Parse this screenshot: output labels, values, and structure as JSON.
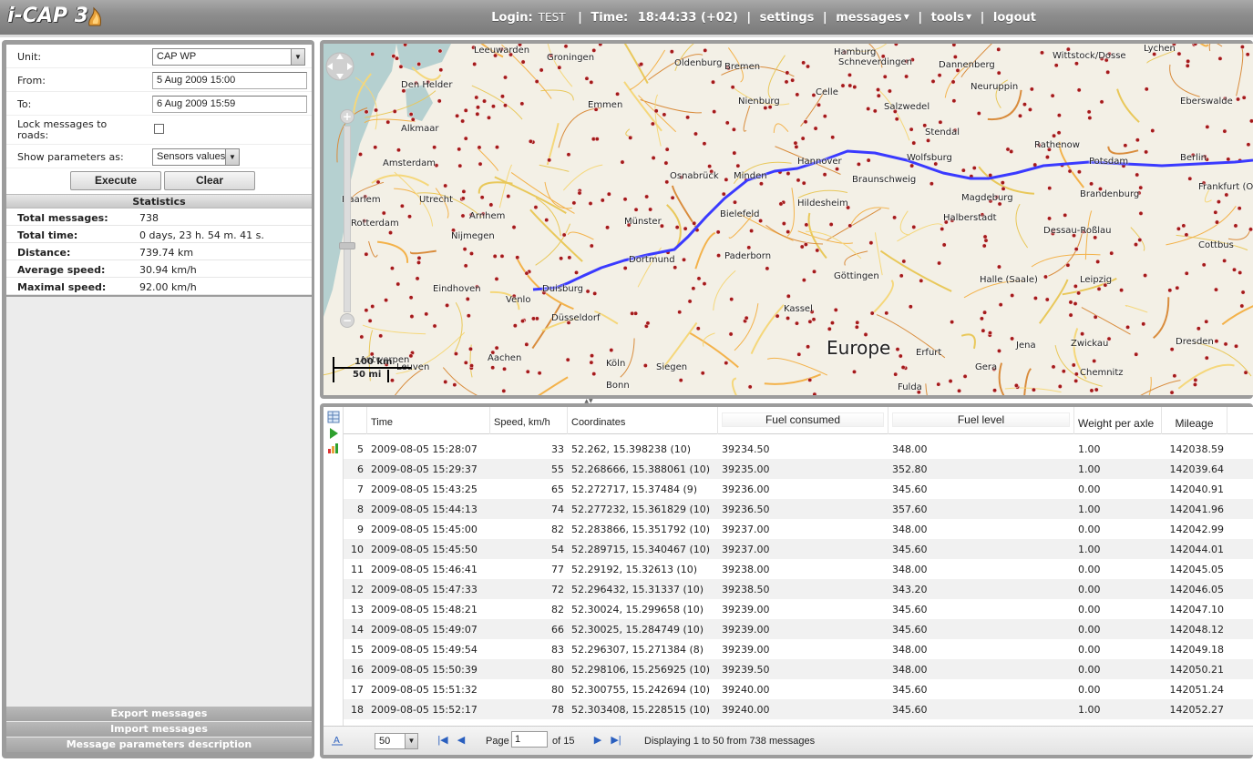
{
  "app": {
    "logo": "i-CAP 3"
  },
  "topnav": {
    "login_label": "Login:",
    "login_value": "TEST",
    "time_label": "Time:",
    "time_value": "18:44:33 (+02)",
    "settings": "settings",
    "messages": "messages",
    "tools": "tools",
    "logout": "logout"
  },
  "form": {
    "unit_label": "Unit:",
    "unit_value": "CAP WP",
    "from_label": "From:",
    "from_value": "5 Aug 2009 15:00",
    "to_label": "To:",
    "to_value": "6 Aug 2009 15:59",
    "lock_label_1": "Lock messages to",
    "lock_label_2": "roads:",
    "lock_checked": false,
    "show_label": "Show parameters as:",
    "show_value": "Sensors values",
    "execute": "Execute",
    "clear": "Clear"
  },
  "stats": {
    "title": "Statistics",
    "rows": [
      {
        "key": "Total messages:",
        "value": "738"
      },
      {
        "key": "Total time:",
        "value": "0 days, 23 h. 54 m. 41 s."
      },
      {
        "key": "Distance:",
        "value": "739.74 km"
      },
      {
        "key": "Average speed:",
        "value": "30.94 km/h"
      },
      {
        "key": "Maximal speed:",
        "value": "92.00 km/h"
      }
    ]
  },
  "bottom_links": {
    "export": "Export messages",
    "import": "Import messages",
    "description": "Message parameters description"
  },
  "map": {
    "region_label": "Europe",
    "scale_km": "100 km",
    "scale_mi": "50 mi",
    "cities": [
      {
        "name": "Leeuwarden"
      },
      {
        "name": "Groningen"
      },
      {
        "name": "Oldenburg"
      },
      {
        "name": "Bremen"
      },
      {
        "name": "Hamburg"
      },
      {
        "name": "Schneverdingen"
      },
      {
        "name": "Dannenberg"
      },
      {
        "name": "Wittstock/Dosse"
      },
      {
        "name": "Lychen"
      },
      {
        "name": "Den Helder"
      },
      {
        "name": "Emmen"
      },
      {
        "name": "Nienburg"
      },
      {
        "name": "Celle"
      },
      {
        "name": "Salzwedel"
      },
      {
        "name": "Neuruppin"
      },
      {
        "name": "Eberswalde"
      },
      {
        "name": "Alkmaar"
      },
      {
        "name": "Amsterdam"
      },
      {
        "name": "Hannover"
      },
      {
        "name": "Wolfsburg"
      },
      {
        "name": "Stendal"
      },
      {
        "name": "Rathenow"
      },
      {
        "name": "Berlin"
      },
      {
        "name": "Potsdam"
      },
      {
        "name": "Haarlem"
      },
      {
        "name": "Utrecht"
      },
      {
        "name": "Osnabrück"
      },
      {
        "name": "Minden"
      },
      {
        "name": "Braunschweig"
      },
      {
        "name": "Magdeburg"
      },
      {
        "name": "Brandenburg"
      },
      {
        "name": "Frankfurt (Oder)"
      },
      {
        "name": "Rotterdam"
      },
      {
        "name": "Arnhem"
      },
      {
        "name": "Münster"
      },
      {
        "name": "Bielefeld"
      },
      {
        "name": "Hildesheim"
      },
      {
        "name": "Halberstadt"
      },
      {
        "name": "Dessau-Roßlau"
      },
      {
        "name": "Cottbus"
      },
      {
        "name": "Nijmegen"
      },
      {
        "name": "Dortmund"
      },
      {
        "name": "Paderborn"
      },
      {
        "name": "Göttingen"
      },
      {
        "name": "Halle (Saale)"
      },
      {
        "name": "Leipzig"
      },
      {
        "name": "Eindhoven"
      },
      {
        "name": "Duisburg"
      },
      {
        "name": "Düsseldorf"
      },
      {
        "name": "Kassel"
      },
      {
        "name": "Erfurt"
      },
      {
        "name": "Gera"
      },
      {
        "name": "Chemnitz"
      },
      {
        "name": "Dresden"
      },
      {
        "name": "Antwerpen"
      },
      {
        "name": "Venlo"
      },
      {
        "name": "Aachen"
      },
      {
        "name": "Köln"
      },
      {
        "name": "Siegen"
      },
      {
        "name": "Fulda"
      },
      {
        "name": "Jena"
      },
      {
        "name": "Zwickau"
      },
      {
        "name": "Leuven"
      },
      {
        "name": "Bonn"
      }
    ]
  },
  "grid": {
    "columns": [
      "Time",
      "Speed, km/h",
      "Coordinates",
      "Fuel consumed",
      "Fuel level",
      "Weight per axle",
      "Mileage"
    ],
    "rows": [
      {
        "n": "5",
        "time": "2009-08-05 15:28:07",
        "speed": "33",
        "coords": "52.262, 15.398238 (10)",
        "fuel_consumed": "39234.50",
        "fuel_level": "348.00",
        "weight": "1.00",
        "mileage": "142038.59"
      },
      {
        "n": "6",
        "time": "2009-08-05 15:29:37",
        "speed": "55",
        "coords": "52.268666, 15.388061 (10)",
        "fuel_consumed": "39235.00",
        "fuel_level": "352.80",
        "weight": "1.00",
        "mileage": "142039.64"
      },
      {
        "n": "7",
        "time": "2009-08-05 15:43:25",
        "speed": "65",
        "coords": "52.272717, 15.37484 (9)",
        "fuel_consumed": "39236.00",
        "fuel_level": "345.60",
        "weight": "0.00",
        "mileage": "142040.91"
      },
      {
        "n": "8",
        "time": "2009-08-05 15:44:13",
        "speed": "74",
        "coords": "52.277232, 15.361829 (10)",
        "fuel_consumed": "39236.50",
        "fuel_level": "357.60",
        "weight": "1.00",
        "mileage": "142041.96"
      },
      {
        "n": "9",
        "time": "2009-08-05 15:45:00",
        "speed": "82",
        "coords": "52.283866, 15.351792 (10)",
        "fuel_consumed": "39237.00",
        "fuel_level": "348.00",
        "weight": "0.00",
        "mileage": "142042.99"
      },
      {
        "n": "10",
        "time": "2009-08-05 15:45:50",
        "speed": "54",
        "coords": "52.289715, 15.340467 (10)",
        "fuel_consumed": "39237.00",
        "fuel_level": "345.60",
        "weight": "1.00",
        "mileage": "142044.01"
      },
      {
        "n": "11",
        "time": "2009-08-05 15:46:41",
        "speed": "77",
        "coords": "52.29192, 15.32613 (10)",
        "fuel_consumed": "39238.00",
        "fuel_level": "348.00",
        "weight": "0.00",
        "mileage": "142045.05"
      },
      {
        "n": "12",
        "time": "2009-08-05 15:47:33",
        "speed": "72",
        "coords": "52.296432, 15.31337 (10)",
        "fuel_consumed": "39238.50",
        "fuel_level": "343.20",
        "weight": "0.00",
        "mileage": "142046.05"
      },
      {
        "n": "13",
        "time": "2009-08-05 15:48:21",
        "speed": "82",
        "coords": "52.30024, 15.299658 (10)",
        "fuel_consumed": "39239.00",
        "fuel_level": "345.60",
        "weight": "0.00",
        "mileage": "142047.10"
      },
      {
        "n": "14",
        "time": "2009-08-05 15:49:07",
        "speed": "66",
        "coords": "52.30025, 15.284749 (10)",
        "fuel_consumed": "39239.00",
        "fuel_level": "345.60",
        "weight": "0.00",
        "mileage": "142048.12"
      },
      {
        "n": "15",
        "time": "2009-08-05 15:49:54",
        "speed": "83",
        "coords": "52.296307, 15.271384 (8)",
        "fuel_consumed": "39239.00",
        "fuel_level": "348.00",
        "weight": "0.00",
        "mileage": "142049.18"
      },
      {
        "n": "16",
        "time": "2009-08-05 15:50:39",
        "speed": "80",
        "coords": "52.298106, 15.256925 (10)",
        "fuel_consumed": "39239.50",
        "fuel_level": "348.00",
        "weight": "0.00",
        "mileage": "142050.21"
      },
      {
        "n": "17",
        "time": "2009-08-05 15:51:32",
        "speed": "80",
        "coords": "52.300755, 15.242694 (10)",
        "fuel_consumed": "39240.00",
        "fuel_level": "345.60",
        "weight": "0.00",
        "mileage": "142051.24"
      },
      {
        "n": "18",
        "time": "2009-08-05 15:52:17",
        "speed": "78",
        "coords": "52.303408, 15.228515 (10)",
        "fuel_consumed": "39240.00",
        "fuel_level": "345.60",
        "weight": "1.00",
        "mileage": "142052.27"
      }
    ]
  },
  "pager": {
    "page_size": "50",
    "page_label": "Page",
    "page_value": "1",
    "of_label": "of 15",
    "status": "Displaying 1 to 50 from 738 messages"
  },
  "colors": {
    "track": "#3a3aff",
    "header_bg": "#8e8e8e",
    "panel_bg": "#9c9c9c",
    "accent_blue": "#2a5fbf"
  }
}
